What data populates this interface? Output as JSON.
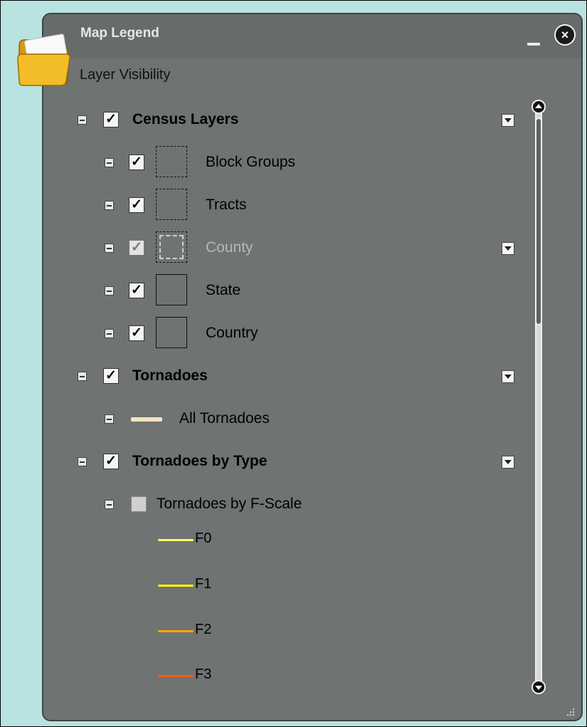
{
  "window": {
    "title": "Map Legend",
    "subtitle": "Layer Visibility",
    "minimize_icon": "minimize-icon",
    "close_icon": "close-icon"
  },
  "groups": [
    {
      "label": "Census Layers",
      "checked": true
    },
    {
      "label": "Tornadoes",
      "checked": true
    },
    {
      "label": "Tornadoes by Type",
      "checked": true
    }
  ],
  "census_layers": [
    {
      "label": "Block Groups",
      "checked": true,
      "swatch": "dashed"
    },
    {
      "label": "Tracts",
      "checked": true,
      "swatch": "dashed"
    },
    {
      "label": "County",
      "checked": true,
      "swatch": "dashed",
      "disabled": true
    },
    {
      "label": "State",
      "checked": true,
      "swatch": "solid"
    },
    {
      "label": "Country",
      "checked": true,
      "swatch": "solid"
    }
  ],
  "tornadoes": [
    {
      "label": "All Tornadoes",
      "color": "#f6e2c4"
    }
  ],
  "tornadoes_by_type": {
    "label": "Tornadoes by F-Scale",
    "checked": false,
    "scale": [
      {
        "label": "F0",
        "color": "#ffff66"
      },
      {
        "label": "F1",
        "color": "#ffff00"
      },
      {
        "label": "F2",
        "color": "#ffa500"
      },
      {
        "label": "F3",
        "color": "#ff5a00"
      }
    ]
  },
  "check_glyph": "✓",
  "close_glyph": "×"
}
